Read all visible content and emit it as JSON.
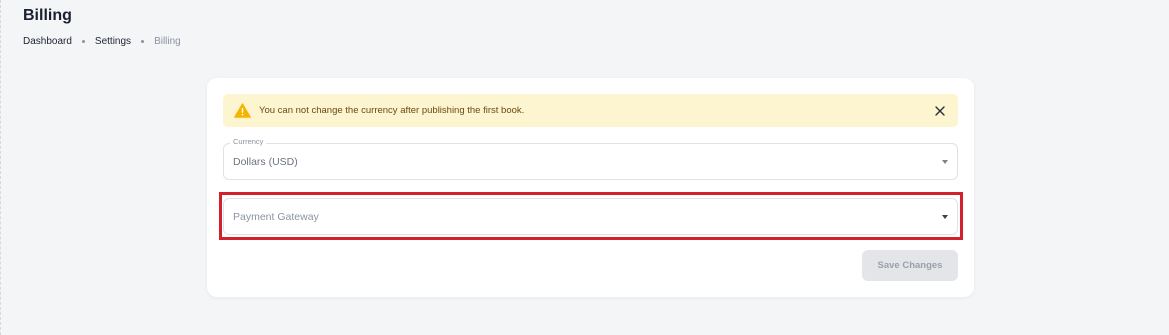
{
  "page": {
    "title": "Billing"
  },
  "breadcrumb": {
    "items": [
      "Dashboard",
      "Settings",
      "Billing"
    ]
  },
  "alert": {
    "message": "You can not change the currency after publishing the first book.",
    "icon": "warning-icon",
    "close_icon": "close-icon",
    "color": "#fdf4d0",
    "icon_color": "#f5b400"
  },
  "form": {
    "currency": {
      "label": "Currency",
      "value": "Dollars (USD)"
    },
    "payment_gateway": {
      "placeholder": "Payment Gateway"
    },
    "save_label": "Save Changes"
  },
  "colors": {
    "highlight": "#d41f2c",
    "background": "#f4f5f7"
  }
}
